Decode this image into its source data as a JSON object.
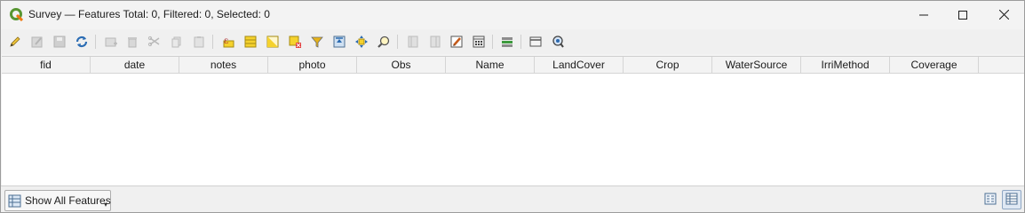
{
  "window": {
    "title": "Survey — Features Total: 0, Filtered: 0, Selected: 0",
    "app_icon": "qgis-logo-icon",
    "controls": [
      "minimize-icon",
      "maximize-icon",
      "close-icon"
    ]
  },
  "toolbar": {
    "buttons": [
      {
        "name": "toggle-editing-icon",
        "enabled": true
      },
      {
        "name": "toggle-multi-edit-icon",
        "enabled": false
      },
      {
        "name": "save-edits-icon",
        "enabled": false
      },
      {
        "name": "reload-table-icon",
        "enabled": true
      },
      {
        "name": "add-feature-icon",
        "enabled": false
      },
      {
        "name": "delete-selected-icon",
        "enabled": false
      },
      {
        "name": "cut-icon",
        "enabled": false
      },
      {
        "name": "copy-icon",
        "enabled": false
      },
      {
        "name": "paste-icon",
        "enabled": false
      },
      {
        "name": "select-by-expression-icon",
        "enabled": true
      },
      {
        "name": "select-all-icon",
        "enabled": true
      },
      {
        "name": "invert-selection-icon",
        "enabled": true
      },
      {
        "name": "deselect-all-icon",
        "enabled": true
      },
      {
        "name": "filter-select-form-icon",
        "enabled": true
      },
      {
        "name": "move-selection-top-icon",
        "enabled": true
      },
      {
        "name": "pan-to-selected-icon",
        "enabled": true
      },
      {
        "name": "zoom-to-selected-icon",
        "enabled": true
      },
      {
        "name": "new-field-icon",
        "enabled": false
      },
      {
        "name": "delete-field-icon",
        "enabled": false
      },
      {
        "name": "organize-columns-icon",
        "enabled": true
      },
      {
        "name": "field-calculator-icon",
        "enabled": true
      },
      {
        "name": "conditional-formatting-icon",
        "enabled": true
      },
      {
        "name": "actions-icon",
        "enabled": true
      },
      {
        "name": "dock-table-icon",
        "enabled": true
      }
    ]
  },
  "table": {
    "columns": [
      "fid",
      "date",
      "notes",
      "photo",
      "Obs",
      "Name",
      "LandCover",
      "Crop",
      "WaterSource",
      "IrriMethod",
      "Coverage"
    ],
    "rows": []
  },
  "bottombar": {
    "show_features_label": "Show All Features",
    "show_features_icon": "table-filter-icon",
    "view_form_icon": "form-view-icon",
    "view_table_icon": "table-view-icon",
    "active_view": "table"
  }
}
